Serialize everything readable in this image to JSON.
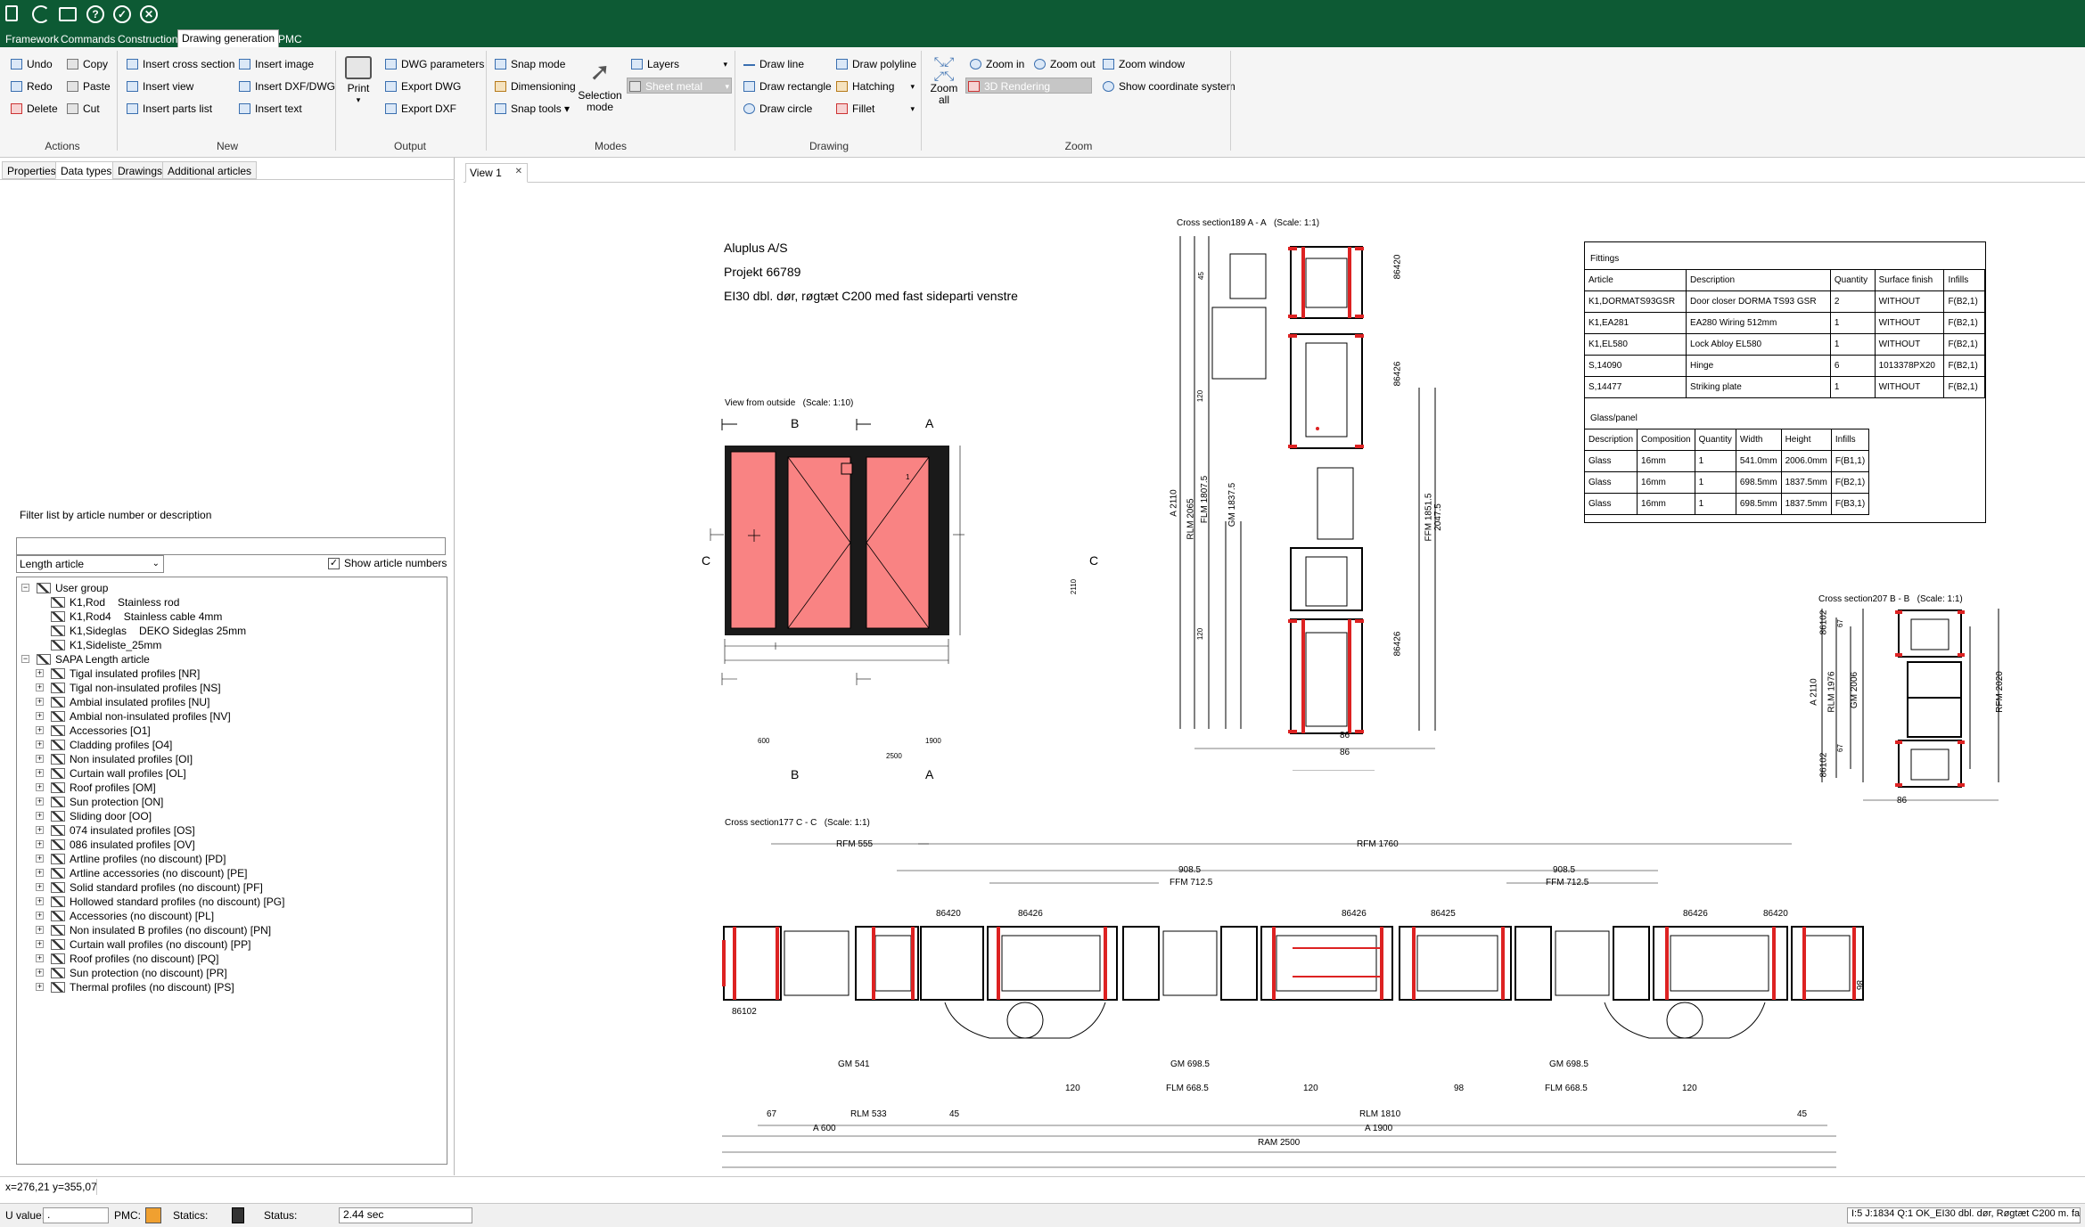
{
  "quick_access": {
    "icons": [
      "document-icon",
      "refresh-icon",
      "print-icon",
      "help-icon",
      "check-icon",
      "close-icon"
    ]
  },
  "menu": {
    "tabs": [
      "Framework",
      "Commands",
      "Construction",
      "Drawing generation",
      "PMC"
    ],
    "active": "Drawing generation"
  },
  "ribbon": {
    "actions": {
      "undo": "Undo",
      "redo": "Redo",
      "delete": "Delete",
      "copy": "Copy",
      "paste": "Paste",
      "cut": "Cut",
      "group": "Actions"
    },
    "new": {
      "insert_cross_section": "Insert cross section",
      "insert_view": "Insert view",
      "insert_parts_list": "Insert parts list",
      "insert_image": "Insert image",
      "insert_dxf_dwg": "Insert DXF/DWG",
      "insert_text": "Insert text",
      "group": "New"
    },
    "output": {
      "print": "Print",
      "dwg_parameters": "DWG parameters",
      "export_dwg": "Export DWG",
      "export_dxf": "Export DXF",
      "group": "Output"
    },
    "modes": {
      "snap_mode": "Snap mode",
      "dimensioning": "Dimensioning",
      "snap_tools": "Snap tools",
      "selection_mode_1": "Selection",
      "selection_mode_2": "mode",
      "layers": "Layers",
      "sheet_metal": "Sheet metal",
      "group": "Modes"
    },
    "drawing": {
      "draw_line": "Draw line",
      "draw_rectangle": "Draw rectangle",
      "draw_circle": "Draw circle",
      "draw_polyline": "Draw polyline",
      "hatching": "Hatching",
      "fillet": "Fillet",
      "group": "Drawing"
    },
    "zoom": {
      "zoom_all_1": "Zoom",
      "zoom_all_2": "all",
      "zoom_in": "Zoom in",
      "zoom_out": "Zoom out",
      "zoom_window": "Zoom window",
      "rendering_3d": "3D Rendering",
      "show_coordinate_system": "Show coordinate system",
      "group": "Zoom"
    }
  },
  "left_panel": {
    "tabs": [
      "Properties",
      "Data types",
      "Drawings",
      "Additional articles"
    ],
    "active_tab": "Data types",
    "filter_label": "Filter list by article number or description",
    "filter_value": "",
    "type_select": "Length article",
    "show_article_numbers": "Show article numbers",
    "tree": [
      {
        "level": 0,
        "label": "User group",
        "desc": ""
      },
      {
        "level": 1,
        "label": "K1,Rod",
        "desc": "Stainless rod"
      },
      {
        "level": 1,
        "label": "K1,Rod4",
        "desc": "Stainless cable 4mm"
      },
      {
        "level": 1,
        "label": "K1,Sideglas",
        "desc": "DEKO Sideglas 25mm"
      },
      {
        "level": 1,
        "label": "K1,Sideliste_25mm",
        "desc": ""
      },
      {
        "level": 0,
        "label": "SAPA Length article",
        "desc": ""
      },
      {
        "level": 1,
        "label": "Tigal insulated profiles [NR]",
        "desc": ""
      },
      {
        "level": 1,
        "label": "Tigal non-insulated profiles [NS]",
        "desc": ""
      },
      {
        "level": 1,
        "label": "Ambial insulated profiles [NU]",
        "desc": ""
      },
      {
        "level": 1,
        "label": "Ambial non-insulated profiles [NV]",
        "desc": ""
      },
      {
        "level": 1,
        "label": "Accessories [O1]",
        "desc": ""
      },
      {
        "level": 1,
        "label": "Cladding profiles [O4]",
        "desc": ""
      },
      {
        "level": 1,
        "label": "Non insulated profiles [OI]",
        "desc": ""
      },
      {
        "level": 1,
        "label": "Curtain wall profiles [OL]",
        "desc": ""
      },
      {
        "level": 1,
        "label": "Roof profiles [OM]",
        "desc": ""
      },
      {
        "level": 1,
        "label": "Sun protection [ON]",
        "desc": ""
      },
      {
        "level": 1,
        "label": "Sliding door [OO]",
        "desc": ""
      },
      {
        "level": 1,
        "label": "074 insulated profiles [OS]",
        "desc": ""
      },
      {
        "level": 1,
        "label": "086 insulated profiles [OV]",
        "desc": ""
      },
      {
        "level": 1,
        "label": "Artline profiles (no discount) [PD]",
        "desc": ""
      },
      {
        "level": 1,
        "label": "Artline accessories (no discount) [PE]",
        "desc": ""
      },
      {
        "level": 1,
        "label": "Solid standard profiles (no discount) [PF]",
        "desc": ""
      },
      {
        "level": 1,
        "label": "Hollowed standard profiles (no discount) [PG]",
        "desc": ""
      },
      {
        "level": 1,
        "label": "Accessories (no discount) [PL]",
        "desc": ""
      },
      {
        "level": 1,
        "label": "Non insulated B profiles (no discount) [PN]",
        "desc": ""
      },
      {
        "level": 1,
        "label": "Curtain wall profiles (no discount) [PP]",
        "desc": ""
      },
      {
        "level": 1,
        "label": "Roof profiles (no discount) [PQ]",
        "desc": ""
      },
      {
        "level": 1,
        "label": "Sun protection (no discount) [PR]",
        "desc": ""
      },
      {
        "level": 1,
        "label": "Thermal profiles (no discount) [PS]",
        "desc": ""
      }
    ]
  },
  "view_tab": {
    "label": "View 1"
  },
  "drawing": {
    "header": {
      "company": "Aluplus A/S",
      "project": "Projekt 66789",
      "description": "EI30 dbl. dør, røgtæt C200 med fast sideparti venstre"
    },
    "view_outside": {
      "title": "View from outside",
      "scale": "(Scale: 1:10)",
      "B": "B",
      "A": "A",
      "C": "C",
      "dim_600": "600",
      "dim_1900": "1900",
      "dim_2500": "2500",
      "dim_2110": "2110",
      "leaf_no": "1"
    },
    "section_aa": {
      "title": "Cross section189  A - A",
      "scale": "(Scale: 1:1)",
      "d45": "45",
      "d120a": "120",
      "d120b": "120",
      "a2110": "A 2110",
      "rlm2065": "RLM 2065",
      "flm1807": "FLM 1807.5",
      "gm1837": "GM 1837.5",
      "ffm1851": "FFM 1851.5",
      "d2047": "2047.5",
      "p86420": "86420",
      "p86426a": "86426",
      "p86426b": "86426",
      "d86a": "86",
      "d86b": "86"
    },
    "section_bb": {
      "title": "Cross section207  B - B",
      "scale": "(Scale: 1:1)",
      "p86102a": "86102",
      "p86102b": "86102",
      "d67a": "67",
      "d67b": "67",
      "a2110": "A 2110",
      "rlm1976": "RLM 1976",
      "gm2006": "GM 2006",
      "rfm2020": "RFM 2020",
      "d86": "86"
    },
    "section_cc": {
      "title": "Cross section177  C - C",
      "scale": "(Scale: 1:1)",
      "rfm555": "RFM 555",
      "rfm1760": "RFM 1760",
      "d908a": "908.5",
      "d908b": "908.5",
      "ffm712a": "FFM 712.5",
      "ffm712b": "FFM 712.5",
      "p86420a": "86420",
      "p86426a": "86426",
      "p86426b": "86426",
      "p86425": "86425",
      "p86426c": "86426",
      "p86420b": "86420",
      "p86102": "86102",
      "gm541": "GM 541",
      "gm698a": "GM 698.5",
      "gm698b": "GM 698.5",
      "d120a": "120",
      "d120b": "120",
      "d120c": "120",
      "d98": "98",
      "flm668a": "FLM 668.5",
      "flm668b": "FLM 668.5",
      "d67": "67",
      "rlm533": "RLM 533",
      "d45a": "45",
      "d45b": "45",
      "rlm1810": "RLM 1810",
      "a600": "A 600",
      "a1900": "A 1900",
      "ram2500": "RAM 2500",
      "d86": "86"
    },
    "fittings": {
      "title": "Fittings",
      "headers": [
        "Article",
        "Description",
        "Quantity",
        "Surface finish",
        "Infills"
      ],
      "rows": [
        [
          "K1,DORMATS93GSR",
          "Door closer DORMA TS93 GSR",
          "2",
          "WITHOUT",
          "F(B2,1)"
        ],
        [
          "K1,EA281",
          "EA280 Wiring 512mm",
          "1",
          "WITHOUT",
          "F(B2,1)"
        ],
        [
          "K1,EL580",
          "Lock Abloy EL580",
          "1",
          "WITHOUT",
          "F(B2,1)"
        ],
        [
          "S,14090",
          "Hinge",
          "6",
          "1013378PX20",
          "F(B2,1)"
        ],
        [
          "S,14477",
          "Striking plate",
          "1",
          "WITHOUT",
          "F(B2,1)"
        ]
      ]
    },
    "glass": {
      "title": "Glass/panel",
      "headers": [
        "Description",
        "Composition",
        "Quantity",
        "Width",
        "Height",
        "Infills"
      ],
      "rows": [
        [
          "Glass",
          "16mm",
          "1",
          "541.0mm",
          "2006.0mm",
          "F(B1,1)"
        ],
        [
          "Glass",
          "16mm",
          "1",
          "698.5mm",
          "1837.5mm",
          "F(B2,1)"
        ],
        [
          "Glass",
          "16mm",
          "1",
          "698.5mm",
          "1837.5mm",
          "F(B3,1)"
        ]
      ]
    }
  },
  "status": {
    "coords": "x=276,21   y=355,07",
    "u_value_label": "U value:",
    "u_value": ".",
    "pmc_label": "PMC:",
    "statics_label": "Statics:",
    "status_label": "Status:",
    "status_value": "2.44 sec",
    "right_info": "I:5 J:1834 Q:1 OK_EI30 dbl. dør, Røgtæt C200 m. fa"
  }
}
